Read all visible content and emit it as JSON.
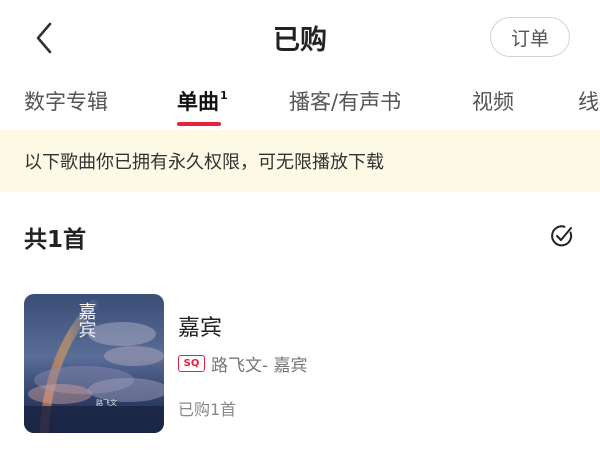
{
  "header": {
    "title": "已购",
    "order_label": "订单"
  },
  "tabs": [
    {
      "label": "数字专辑",
      "badge": ""
    },
    {
      "label": "单曲",
      "badge": "1"
    },
    {
      "label": "播客/有声书",
      "badge": ""
    },
    {
      "label": "视频",
      "badge": ""
    },
    {
      "label": "线",
      "badge": ""
    }
  ],
  "active_tab": 1,
  "notice": "以下歌曲你已拥有永久权限，可无限播放下载",
  "count_label": "共1首",
  "song": {
    "title": "嘉宾",
    "quality_badge": "SQ",
    "artist_line": "路飞文- 嘉宾",
    "bought_text": "已购1首",
    "cover_text": "嘉宾",
    "cover_signature": "路飞文"
  },
  "colors": {
    "accent": "#e8223b",
    "notice_bg": "#fcf9e5"
  },
  "icons": {
    "back": "chevron-left-icon",
    "check": "check-circle-icon"
  }
}
